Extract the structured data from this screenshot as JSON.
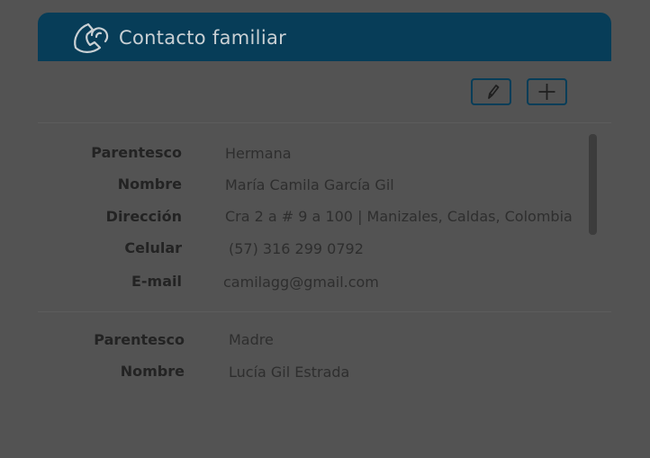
{
  "header": {
    "title": "Contacto familiar",
    "icon": "phone-contact-icon"
  },
  "toolbar": {
    "edit_icon": "pencil-icon",
    "add_icon": "plus-icon"
  },
  "colors": {
    "header_bg": "#073d58",
    "overlay_bg": "#535353"
  },
  "contacts": [
    {
      "parentesco_label": "Parentesco",
      "parentesco": "Hermana",
      "nombre_label": "Nombre",
      "nombre": "María Camila García Gil",
      "direccion_label": "Dirección",
      "direccion": "Cra 2 a # 9 a 100 | Manizales, Caldas, Colombia",
      "celular_label": "Celular",
      "celular": "(57) 316 299 0792",
      "email_label": "E-mail",
      "email": "camilagg@gmail.com"
    },
    {
      "parentesco_label": "Parentesco",
      "parentesco": "Madre",
      "nombre_label": "Nombre",
      "nombre": "Lucía Gil Estrada"
    }
  ]
}
